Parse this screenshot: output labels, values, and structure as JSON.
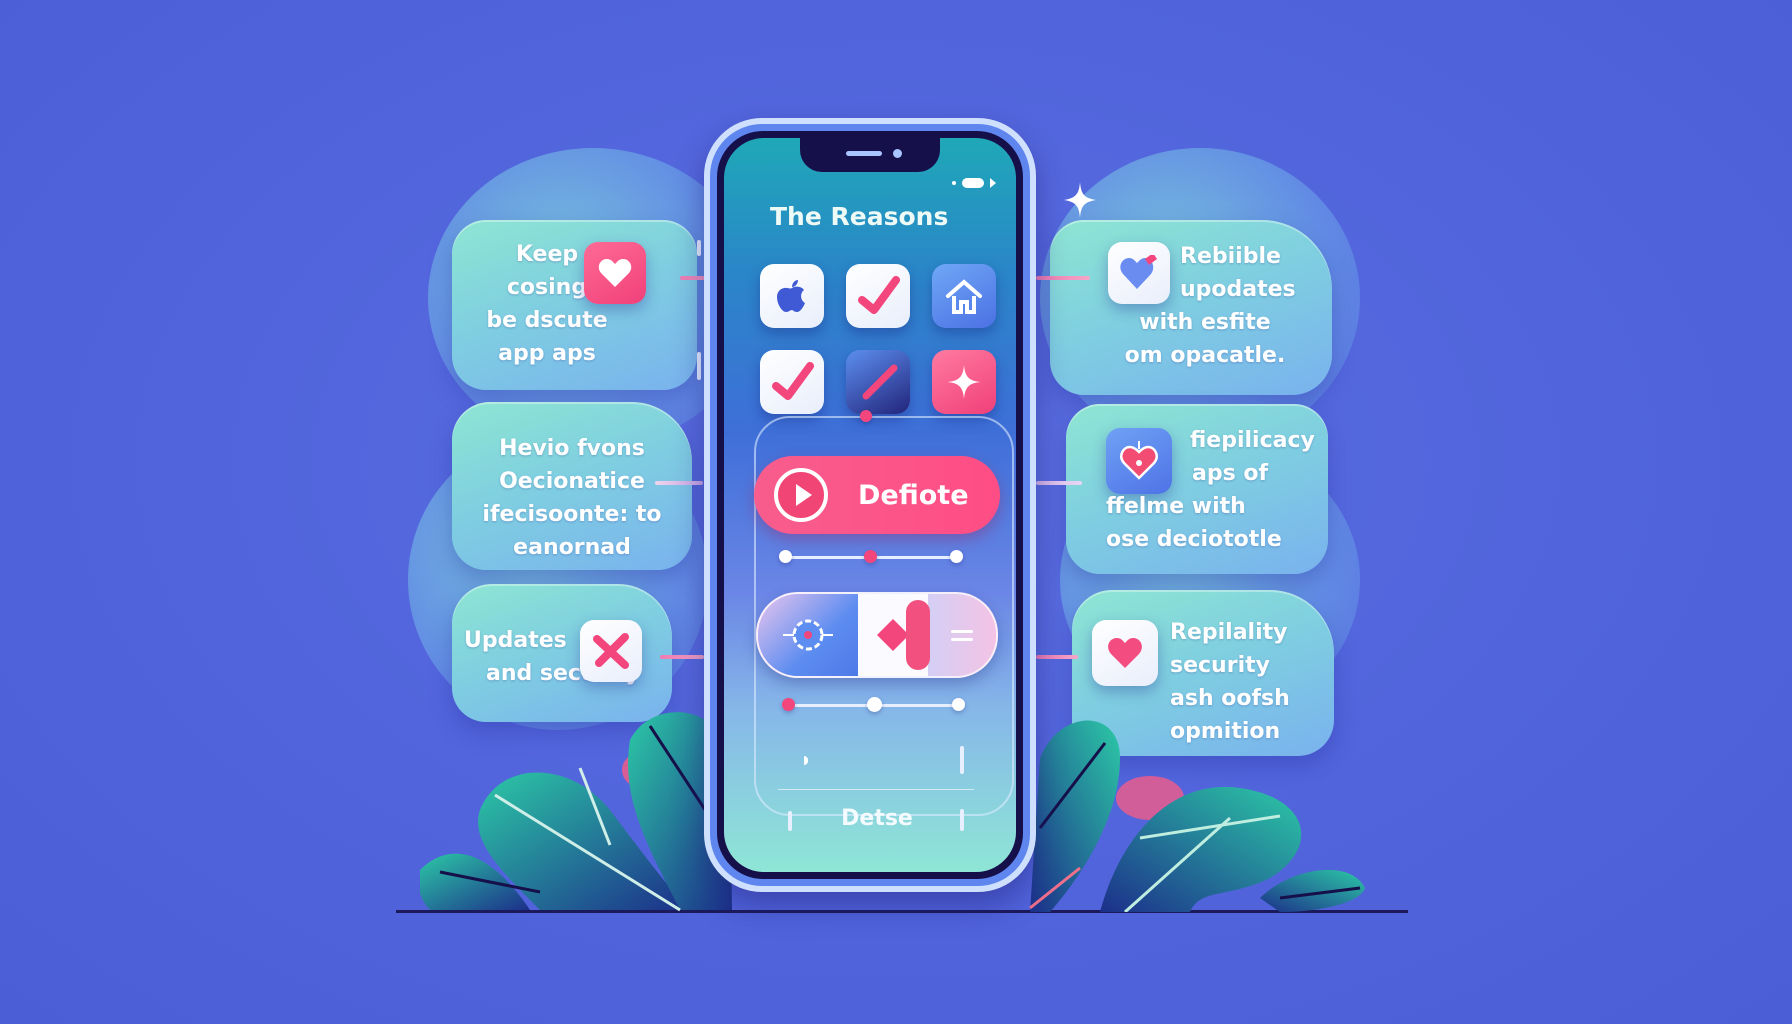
{
  "scene": {
    "colors": {
      "background": "#5164dc",
      "card_gradient_top": "#8ee6d2",
      "card_gradient_bottom": "#79b2ee",
      "accent_pink": "#f2467c",
      "phone_frame": "#5f86ee",
      "leaf": "#1fa89a"
    }
  },
  "phone": {
    "screen_title": "The Reasons",
    "status_icons": [
      "signal-dot-icon",
      "battery-icon",
      "arrow-icon"
    ],
    "app_icons": [
      {
        "name": "apple-logo-icon",
        "style": "white"
      },
      {
        "name": "checkmark-icon",
        "style": "white"
      },
      {
        "name": "home-icon",
        "style": "blue"
      },
      {
        "name": "checkmark-icon",
        "style": "white"
      },
      {
        "name": "checkmark-icon",
        "style": "blue"
      },
      {
        "name": "sparkle-star-icon",
        "style": "pink"
      }
    ],
    "primary_button": {
      "label": "Defiote",
      "icon": "play-icon"
    },
    "slider_1": {
      "value": 0.5
    },
    "segmented_toggle": {
      "segments": [
        "gear-icon",
        "diamond-icon",
        "menu-lines-icon"
      ]
    },
    "slider_2": {
      "value": 0.5
    },
    "footer_label": "Detse"
  },
  "left_cards": [
    {
      "text": [
        "Keep",
        "cosing",
        "be dscute",
        "app aps"
      ],
      "icon": "heart-icon"
    },
    {
      "text": [
        "Hevio fvons",
        "Oecionatice",
        "ifecisoonte: to",
        "eanornad"
      ],
      "icon": null
    },
    {
      "text": [
        "Updates",
        "and security"
      ],
      "icon": "cross-mark-icon"
    }
  ],
  "right_cards": [
    {
      "text": [
        "Rebiible",
        "upodates",
        "with esfite",
        "om opacatle."
      ],
      "icon": "heart-icon"
    },
    {
      "text": [
        "fiepilicacy",
        "aps of",
        "ffelme with",
        "ose deciototle"
      ],
      "icon": "heart-lock-icon"
    },
    {
      "text": [
        "Repilality",
        "security",
        "ash oofsh",
        "opmition"
      ],
      "icon": "heart-icon"
    }
  ]
}
